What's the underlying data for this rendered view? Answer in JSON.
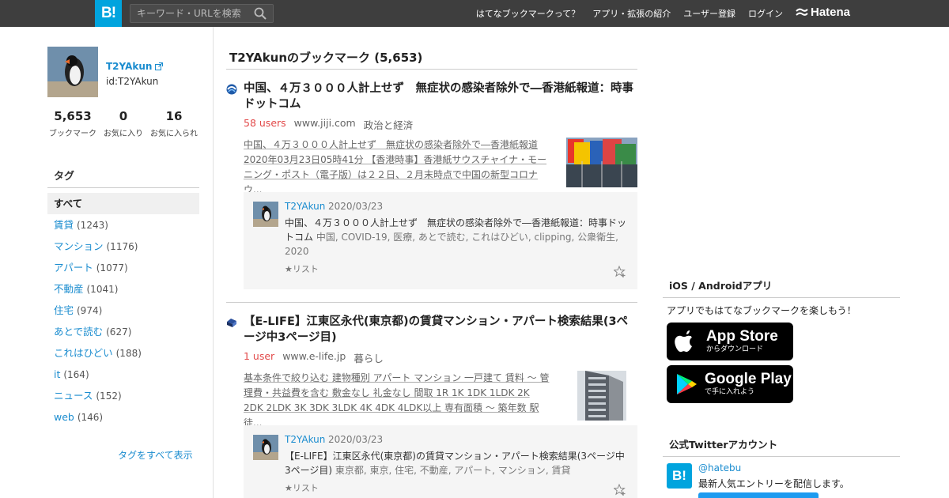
{
  "header": {
    "logo": "B!",
    "search_placeholder": "キーワード・URLを検索",
    "nav": [
      "はてなブックマークって？",
      "アプリ・拡張の紹介",
      "ユーザー登録",
      "ログイン"
    ],
    "hatena": "Hatena"
  },
  "profile": {
    "name": "T2YAkun",
    "id": "id:T2YAkun",
    "stats": [
      {
        "num": "5,653",
        "label": "ブックマーク"
      },
      {
        "num": "0",
        "label": "お気に入り"
      },
      {
        "num": "16",
        "label": "お気に入られ"
      }
    ],
    "tags_heading": "タグ",
    "tags": [
      {
        "name": "すべて",
        "count": ""
      },
      {
        "name": "賃貸",
        "count": "(1243)"
      },
      {
        "name": "マンション",
        "count": "(1176)"
      },
      {
        "name": "アパート",
        "count": "(1077)"
      },
      {
        "name": "不動産",
        "count": "(1041)"
      },
      {
        "name": "住宅",
        "count": "(974)"
      },
      {
        "name": "あとで読む",
        "count": "(627)"
      },
      {
        "name": "これはひどい",
        "count": "(188)"
      },
      {
        "name": "it",
        "count": "(164)"
      },
      {
        "name": "ニュース",
        "count": "(152)"
      },
      {
        "name": "web",
        "count": "(146)"
      }
    ],
    "all_tags_link": "タグをすべて表示"
  },
  "main": {
    "title": "T2YAkunのブックマーク (5,653)",
    "entries": [
      {
        "title": "中国、４万３０００人計上せず　無症状の感染者除外で―香港紙報道：時事ドットコム",
        "users": "58 users",
        "domain": "www.jiji.com",
        "category": "政治と経済",
        "excerpt": "中国、４万３０００人計上せず　無症状の感染者除外で―香港紙報道 2020年03月23日05時41分 【香港時事】香港紙サウスチャイナ・モーニング・ポスト（電子版）は２２日、２月末時点で中国の新型コロナウ...",
        "comment_user": "T2YAkun",
        "comment_date": "2020/03/23",
        "comment_title": "中国、４万３０００人計上せず　無症状の感染者除外で―香港紙報道：時事ドットコム",
        "comment_tags": "中国, COVID-19, 医療, あとで読む, これはひどい, clipping, 公衆衛生, 2020",
        "list_label": "★リスト"
      },
      {
        "title": "【E-LIFE】江東区永代(東京都)の賃貸マンション・アパート検索結果(3ページ中3ページ目)",
        "users": "1 user",
        "domain": "www.e-life.jp",
        "category": "暮らし",
        "excerpt": "基本条件で絞り込む 建物種別 アパート マンション 一戸建て 賃料 〜 管理費・共益費を含む 敷金なし 礼金なし 間取 1R 1K 1DK 1LDK 2K 2DK 2LDK 3K 3DK 3LDK 4K 4DK 4LDK以上 専有面積 〜 築年数 駅徒...",
        "comment_user": "T2YAkun",
        "comment_date": "2020/03/23",
        "comment_title": "【E-LIFE】江東区永代(東京都)の賃貸マンション・アパート検索結果(3ページ中3ページ目)",
        "comment_tags": "東京都, 東京, 住宅, 不動産, アパート, マンション, 賃貸",
        "list_label": "★リスト"
      }
    ]
  },
  "right": {
    "apps_heading": "iOS / Androidアプリ",
    "apps_text": "アプリでもはてなブックマークを楽しもう！",
    "appstore_big": "App Store",
    "appstore_small": "からダウンロード",
    "googleplay_big": "Google Play",
    "googleplay_small": "で手に入れよう",
    "twitter_heading": "公式Twitterアカウント",
    "twitter_handle": "@hatebu",
    "twitter_desc": "最新人気エントリーを配信します。"
  },
  "colors": {
    "accent": "#00a4de",
    "users": "#e24a4a",
    "link": "#1a8ccf"
  }
}
